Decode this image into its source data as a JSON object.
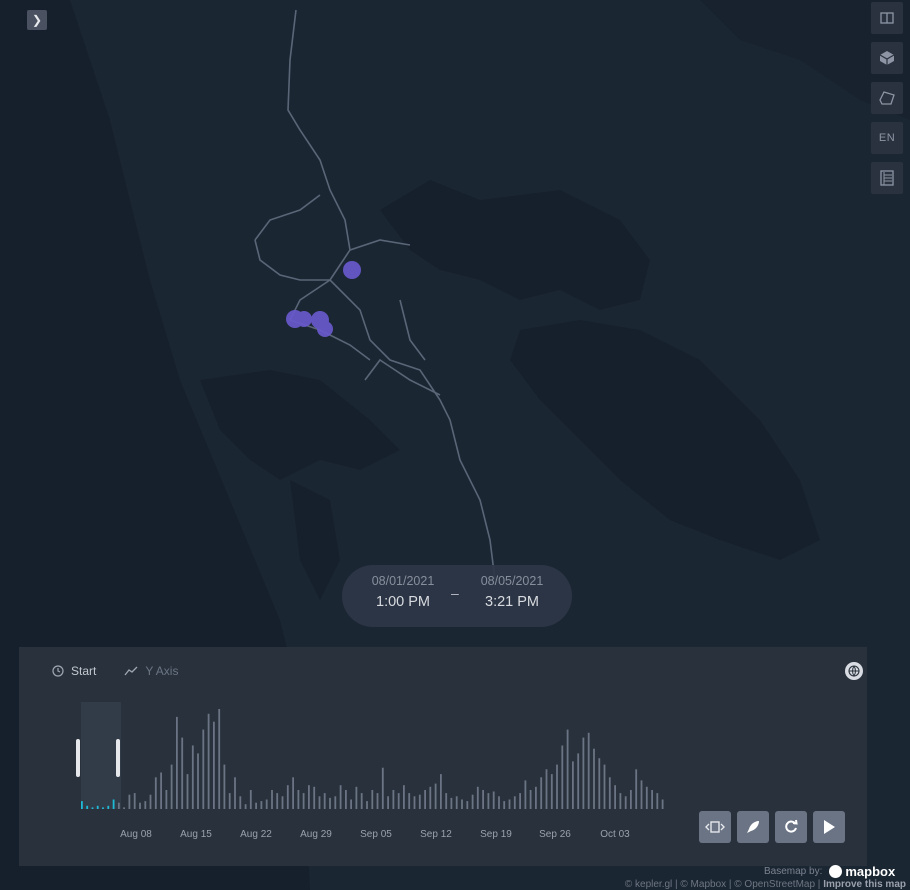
{
  "map": {
    "point_color": "#6a5acd",
    "road_color": "#5a6677",
    "land_color": "#1b2633",
    "water_color": "#16202c"
  },
  "sidebar_toggle": {
    "icon": "chevron-right-icon"
  },
  "map_controls": [
    {
      "icon": "split-map-icon"
    },
    {
      "icon": "3d-cube-icon"
    },
    {
      "icon": "draw-polygon-icon"
    },
    {
      "label": "EN"
    },
    {
      "icon": "legend-icon"
    }
  ],
  "time_display": {
    "start_date": "08/01/2021",
    "start_time": "1:00 PM",
    "separator": "–",
    "end_date": "08/05/2021",
    "end_time": "3:21 PM"
  },
  "timeline": {
    "start_label": "Start",
    "yaxis_label": "Y Axis",
    "ticks": [
      "Aug 08",
      "Aug 15",
      "Aug 22",
      "Aug 29",
      "Sep 05",
      "Sep 12",
      "Sep 19",
      "Sep 26",
      "Oct 03"
    ],
    "selection_color": "#1fbad6"
  },
  "chart_data": {
    "type": "bar",
    "categories": [
      "Aug 08",
      "Aug 15",
      "Aug 22",
      "Aug 29",
      "Sep 05",
      "Sep 12",
      "Sep 19",
      "Sep 26",
      "Oct 03"
    ],
    "values": [
      5,
      2,
      1,
      2,
      1,
      2,
      6,
      4,
      1,
      9,
      10,
      4,
      5,
      9,
      20,
      23,
      12,
      28,
      58,
      45,
      22,
      40,
      35,
      50,
      60,
      55,
      63,
      28,
      10,
      20,
      8,
      3,
      12,
      4,
      5,
      6,
      12,
      10,
      8,
      15,
      20,
      12,
      10,
      15,
      14,
      8,
      10,
      7,
      8,
      15,
      12,
      6,
      14,
      10,
      5,
      12,
      10,
      26,
      8,
      12,
      10,
      15,
      10,
      8,
      9,
      12,
      14,
      16,
      22,
      10,
      7,
      8,
      6,
      5,
      9,
      14,
      12,
      10,
      11,
      8,
      5,
      6,
      8,
      10,
      18,
      12,
      14,
      20,
      25,
      22,
      28,
      40,
      50,
      30,
      35,
      45,
      48,
      38,
      32,
      28,
      20,
      15,
      10,
      8,
      12,
      25,
      18,
      14,
      12,
      10,
      6
    ]
  },
  "play_controls": [
    {
      "icon": "speed-icon"
    },
    {
      "icon": "rocket-icon"
    },
    {
      "icon": "loop-icon"
    },
    {
      "icon": "play-icon"
    }
  ],
  "attribution": {
    "basemap_label": "Basemap by:",
    "brand": "mapbox",
    "text": "© kepler.gl | © Mapbox | © OpenStreetMap |",
    "improve": "Improve this map"
  }
}
